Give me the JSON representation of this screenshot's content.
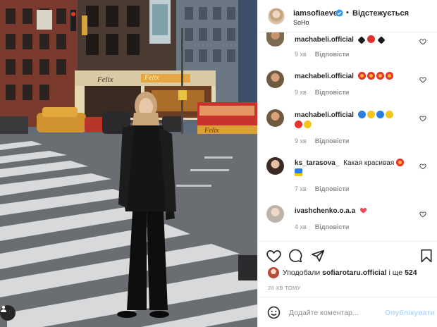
{
  "post": {
    "username": "iamsofiaeve",
    "separator": "•",
    "follow_status": "Відстежується",
    "location": "SoHo"
  },
  "photo_signs": {
    "felix_top": "Felix",
    "felix_neon": "Felix",
    "felix_cart": "Felix"
  },
  "comments": [
    {
      "user": "machabeli.official",
      "text": "",
      "emojis": [
        "#1a1a1a",
        "#e0302b",
        "#1a1a1a"
      ],
      "time": "9 хв",
      "reply": "Відповісти"
    },
    {
      "user": "machabeli.official",
      "text": "",
      "emojis": [
        "#e8332f",
        "#e8332f",
        "#e8332f",
        "#e8332f"
      ],
      "time": "9 хв",
      "reply": "Відповісти"
    },
    {
      "user": "machabeli.official",
      "text": "",
      "emojis": [
        "#2a7de1",
        "#f5c518",
        "#2a7de1",
        "#f5c518",
        "#e8332f",
        "#f5c518"
      ],
      "time": "9 хв",
      "reply": "Відповісти"
    },
    {
      "user": "ks_tarasova_",
      "text": "Какая красивая",
      "emojis": [
        "#e8332f",
        "#2a7de1"
      ],
      "time": "7 хв",
      "reply": "Відповісти"
    },
    {
      "user": "ivashchenko.o.a.a",
      "text": "",
      "emojis": [
        "#ed4956"
      ],
      "time": "4 хв",
      "reply": "Відповісти"
    }
  ],
  "likes": {
    "prefix": "Уподобали",
    "first_user": "sofiarotaru.official",
    "connector": "і ще",
    "count": "524"
  },
  "timestamp": "20 ХВ ТОМУ",
  "add_comment": {
    "placeholder": "Додайте коментар...",
    "post_button": "Опублікувати"
  },
  "colors": {
    "verified": "#3897f0",
    "like_heart": "#ed4956",
    "post_disabled": "#b3dbff",
    "muted_text": "#8e8e8e"
  },
  "icons": [
    "verified-badge-icon",
    "heart-icon",
    "comment-icon",
    "share-icon",
    "bookmark-icon",
    "emoji-icon"
  ]
}
